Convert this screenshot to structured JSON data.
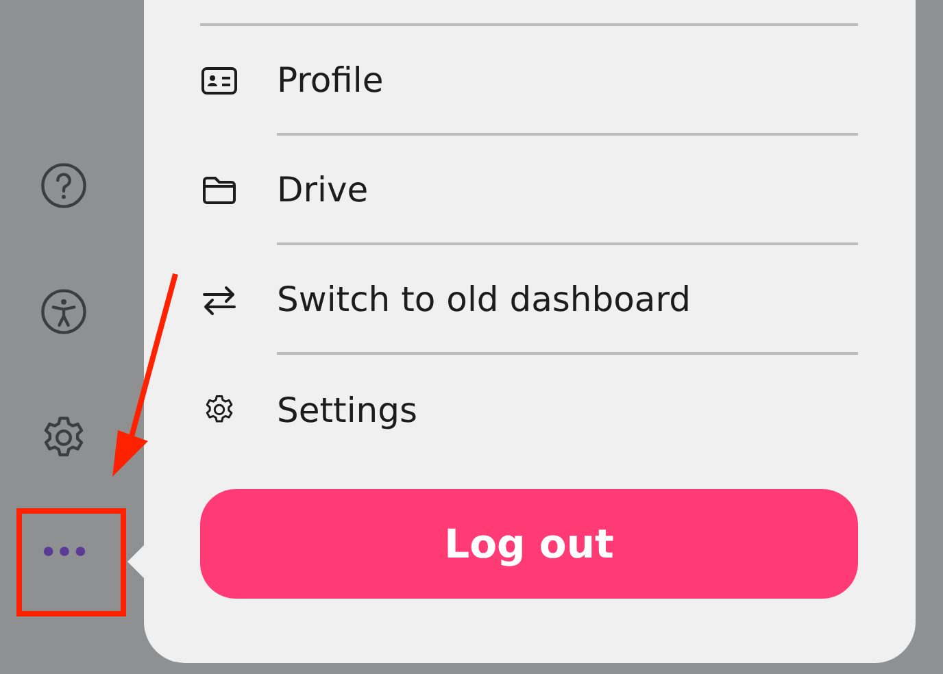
{
  "sidebar": {
    "items": [
      {
        "kind": "help"
      },
      {
        "kind": "accessibility"
      },
      {
        "kind": "settings"
      },
      {
        "kind": "more"
      }
    ]
  },
  "menu": {
    "items": [
      {
        "kind": "profile",
        "label": "Profile"
      },
      {
        "kind": "drive",
        "label": "Drive"
      },
      {
        "kind": "switch",
        "label": "Switch to old dashboard"
      },
      {
        "kind": "settings",
        "label": "Settings"
      }
    ],
    "logout_button": "Log out"
  }
}
